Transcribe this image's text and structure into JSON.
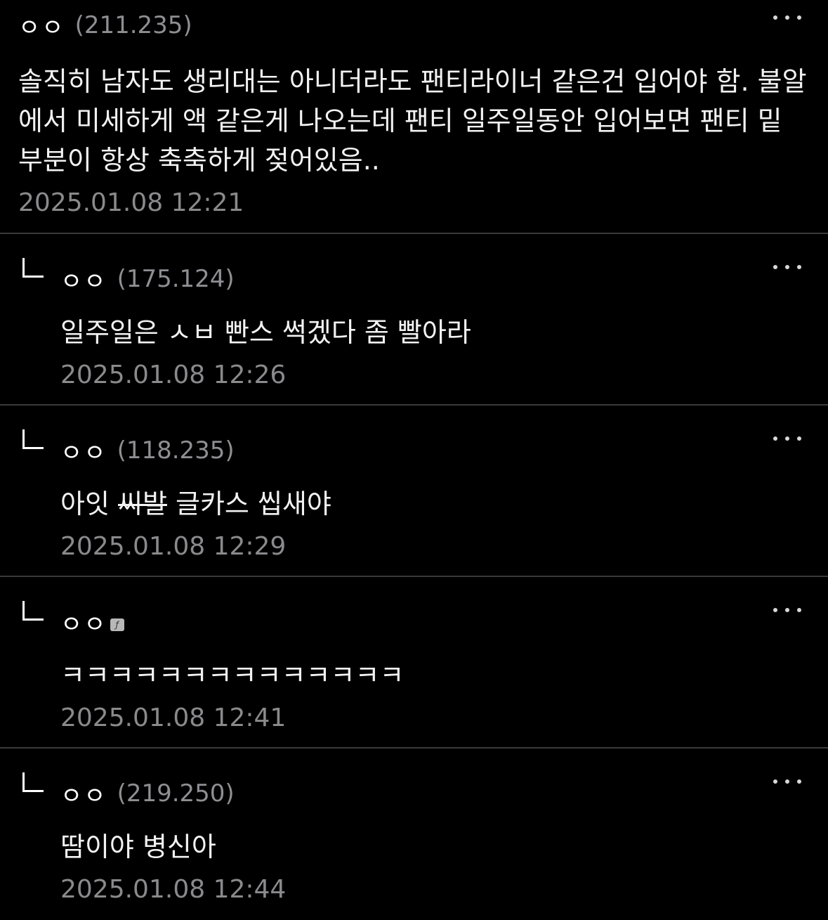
{
  "post": {
    "author": "ㅇㅇ",
    "ip": "(211.235)",
    "text": "솔직히 남자도 생리대는 아니더라도 팬티라이너 같은건 입어야 함. 불알에서 미세하게 액 같은게 나오는데 팬티 일주일동안 입어보면 팬티 밑 부분이 항상 축축하게 젖어있음..",
    "time": "2025.01.08 12:21"
  },
  "replies": [
    {
      "author": "ㅇㅇ",
      "ip": "(175.124)",
      "text": "일주일은 ㅅㅂ 빤스 썩겠다 좀 빨아라",
      "time": "2025.01.08 12:26"
    },
    {
      "author": "ㅇㅇ",
      "ip": "(118.235)",
      "text_pre": "아잇 ",
      "text_strike": "씨발",
      "text_post": " 글카스 씹새야",
      "time": "2025.01.08 12:29"
    },
    {
      "author": "ㅇㅇ",
      "ip": "",
      "text": "ㅋㅋㅋㅋㅋㅋㅋㅋㅋㅋㅋㅋㅋㅋ",
      "time": "2025.01.08 12:41",
      "badge_icon": "fixed-nick-icon"
    },
    {
      "author": "ㅇㅇ",
      "ip": "(219.250)",
      "text": "땀이야 병신아",
      "time": "2025.01.08 12:44"
    }
  ],
  "icons": {
    "more": "more-dots-icon",
    "reply": "reply-arrow-icon"
  },
  "colors": {
    "background": "#000000",
    "text": "#f2f2f2",
    "meta": "#8e8e93",
    "divider": "#3a3a3c"
  }
}
